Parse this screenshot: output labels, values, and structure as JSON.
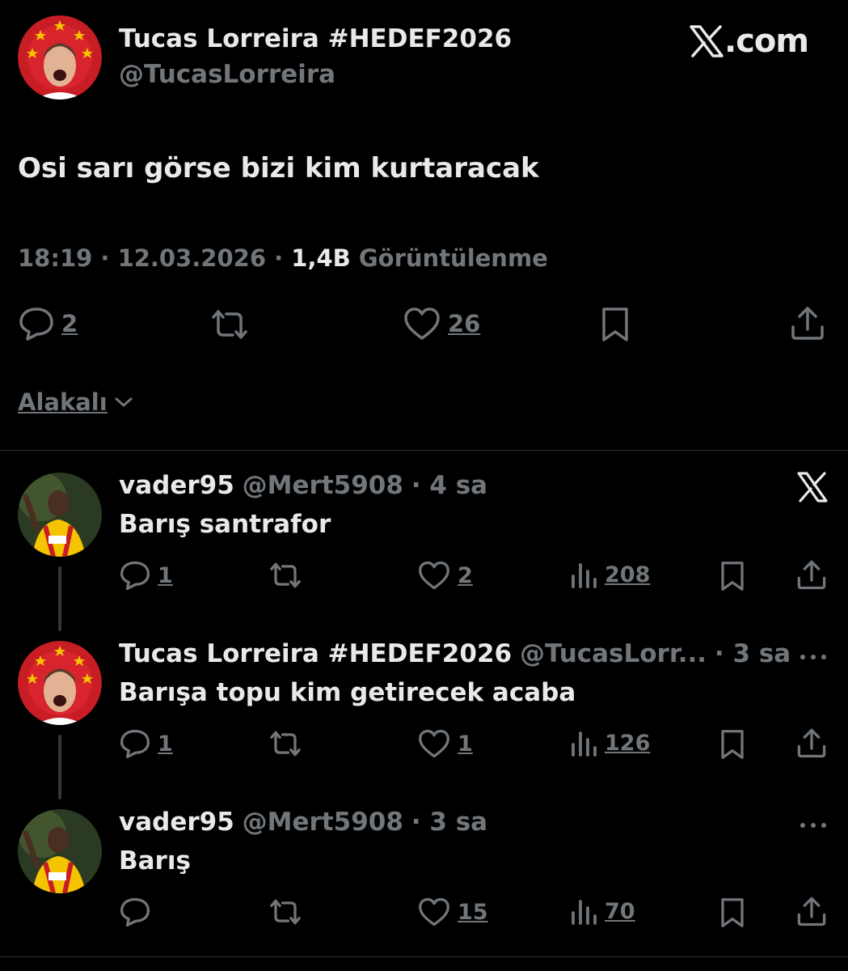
{
  "main_tweet": {
    "display_name": "Tucas Lorreira #HEDEF2026",
    "handle": "@TucasLorreira",
    "text": "Osi sarı görse bizi kim kurtaracak",
    "time": "18:19",
    "separator": "·",
    "date": "12.03.2026",
    "views_count": "1,4B",
    "views_label": "Görüntülenme",
    "actions": {
      "replies": "2",
      "likes": "26"
    }
  },
  "watermark": ".com",
  "sort": {
    "label": "Alakalı"
  },
  "replies": [
    {
      "display_name": "vader95",
      "handle": "@Mert5908",
      "age": "· 4 sa",
      "text": "Barış santrafor",
      "replies": "1",
      "likes": "2",
      "views": "208"
    },
    {
      "display_name": "Tucas Lorreira #HEDEF2026",
      "handle": "@TucasLorr...",
      "age": "· 3 sa",
      "text": "Barışa topu kim getirecek acaba",
      "replies": "1",
      "likes": "1",
      "views": "126"
    },
    {
      "display_name": "vader95",
      "handle": "@Mert5908",
      "age": "· 3 sa",
      "text": "Barış",
      "replies": "",
      "likes": "15",
      "views": "70"
    }
  ],
  "icons": {
    "reply": "reply-icon",
    "retweet": "retweet-icon",
    "like": "heart-icon",
    "views": "views-icon",
    "bookmark": "bookmark-icon",
    "share": "share-icon",
    "more": "more-icon",
    "x_logo": "x-logo-icon"
  },
  "colors": {
    "background": "#000000",
    "text": "#e7e9ea",
    "secondary": "#71767b",
    "divider": "#2f3336",
    "avatar_red": "#c81d25",
    "avatar_gold": "#f5c400"
  }
}
